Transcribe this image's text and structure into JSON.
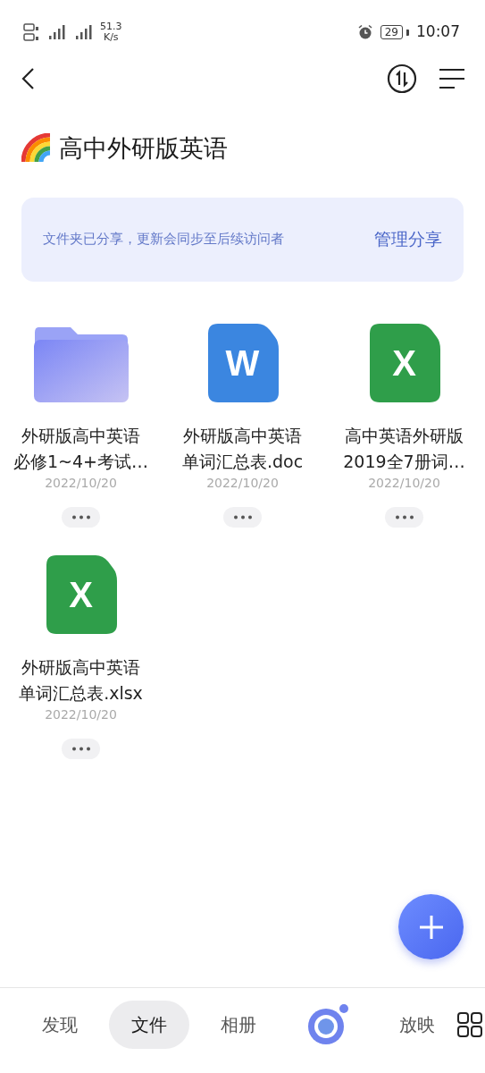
{
  "status_bar": {
    "speed": "51.3",
    "speed_unit": "K/s",
    "battery": "29",
    "time": "10:07"
  },
  "title": "高中外研版英语",
  "share_banner": {
    "message": "文件夹已分享，更新会同步至后续访问者",
    "action": "管理分享"
  },
  "files": [
    {
      "kind": "folder",
      "name_lines": [
        "外研版高中英语",
        "必修1~4+考试…"
      ],
      "date": "2022/10/20"
    },
    {
      "kind": "word",
      "icon_letter": "W",
      "name_lines": [
        "外研版高中英语",
        "单词汇总表.doc"
      ],
      "date": "2022/10/20"
    },
    {
      "kind": "excel",
      "icon_letter": "X",
      "name_lines": [
        "高中英语外研版",
        "2019全7册词…"
      ],
      "date": "2022/10/20"
    },
    {
      "kind": "excel",
      "icon_letter": "X",
      "name_lines": [
        "外研版高中英语",
        "单词汇总表.xlsx"
      ],
      "date": "2022/10/20"
    }
  ],
  "bottom_nav": [
    {
      "kind": "text",
      "label": "发现",
      "selected": false
    },
    {
      "kind": "text",
      "label": "文件",
      "selected": true
    },
    {
      "kind": "text",
      "label": "相册",
      "selected": false
    },
    {
      "kind": "assistant",
      "selected": false
    },
    {
      "kind": "text",
      "label": "放映",
      "selected": false
    }
  ]
}
